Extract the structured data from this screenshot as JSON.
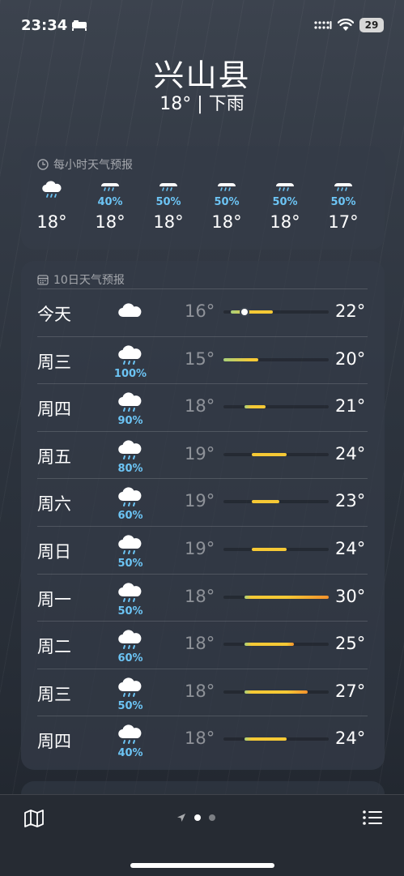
{
  "status_bar": {
    "time": "23:34",
    "battery": "29"
  },
  "header": {
    "city": "兴山县",
    "current": "18° | 下雨"
  },
  "hourly": {
    "title": "每小时天气预报",
    "items": [
      {
        "pct": "",
        "temp": "18°",
        "icon": "rain-cloud-icon"
      },
      {
        "pct": "40%",
        "temp": "18°",
        "icon": "rain-icon"
      },
      {
        "pct": "50%",
        "temp": "18°",
        "icon": "rain-icon"
      },
      {
        "pct": "50%",
        "temp": "18°",
        "icon": "rain-icon"
      },
      {
        "pct": "50%",
        "temp": "18°",
        "icon": "rain-icon"
      },
      {
        "pct": "50%",
        "temp": "17°",
        "icon": "rain-icon"
      }
    ]
  },
  "daily": {
    "title": "10日天气预报",
    "range": {
      "min": 15,
      "max": 30
    },
    "current_temp": 18,
    "days": [
      {
        "day": "今天",
        "icon": "cloud-icon",
        "pct": "",
        "lo": "16°",
        "hi": "22°",
        "lo_v": 16,
        "hi_v": 22,
        "current": true
      },
      {
        "day": "周三",
        "icon": "rain-cloud-icon",
        "pct": "100%",
        "lo": "15°",
        "hi": "20°",
        "lo_v": 15,
        "hi_v": 20
      },
      {
        "day": "周四",
        "icon": "rain-cloud-icon",
        "pct": "90%",
        "lo": "18°",
        "hi": "21°",
        "lo_v": 18,
        "hi_v": 21
      },
      {
        "day": "周五",
        "icon": "rain-cloud-icon",
        "pct": "80%",
        "lo": "19°",
        "hi": "24°",
        "lo_v": 19,
        "hi_v": 24
      },
      {
        "day": "周六",
        "icon": "rain-cloud-icon",
        "pct": "60%",
        "lo": "19°",
        "hi": "23°",
        "lo_v": 19,
        "hi_v": 23
      },
      {
        "day": "周日",
        "icon": "rain-cloud-icon",
        "pct": "50%",
        "lo": "19°",
        "hi": "24°",
        "lo_v": 19,
        "hi_v": 24
      },
      {
        "day": "周一",
        "icon": "rain-cloud-icon",
        "pct": "50%",
        "lo": "18°",
        "hi": "30°",
        "lo_v": 18,
        "hi_v": 30
      },
      {
        "day": "周二",
        "icon": "rain-cloud-icon",
        "pct": "60%",
        "lo": "18°",
        "hi": "25°",
        "lo_v": 18,
        "hi_v": 25
      },
      {
        "day": "周三",
        "icon": "rain-cloud-icon",
        "pct": "50%",
        "lo": "18°",
        "hi": "27°",
        "lo_v": 18,
        "hi_v": 27
      },
      {
        "day": "周四",
        "icon": "rain-cloud-icon",
        "pct": "40%",
        "lo": "18°",
        "hi": "24°",
        "lo_v": 18,
        "hi_v": 24
      }
    ]
  },
  "colors": {
    "precip": "#6cc4f4",
    "cool": "#a8d07a",
    "warm": "#f6c935",
    "hot": "#f3922c"
  },
  "bottom_bar": {
    "left_icon": "map-icon",
    "right_icon": "list-icon",
    "pages": 2,
    "active_page": 0
  }
}
